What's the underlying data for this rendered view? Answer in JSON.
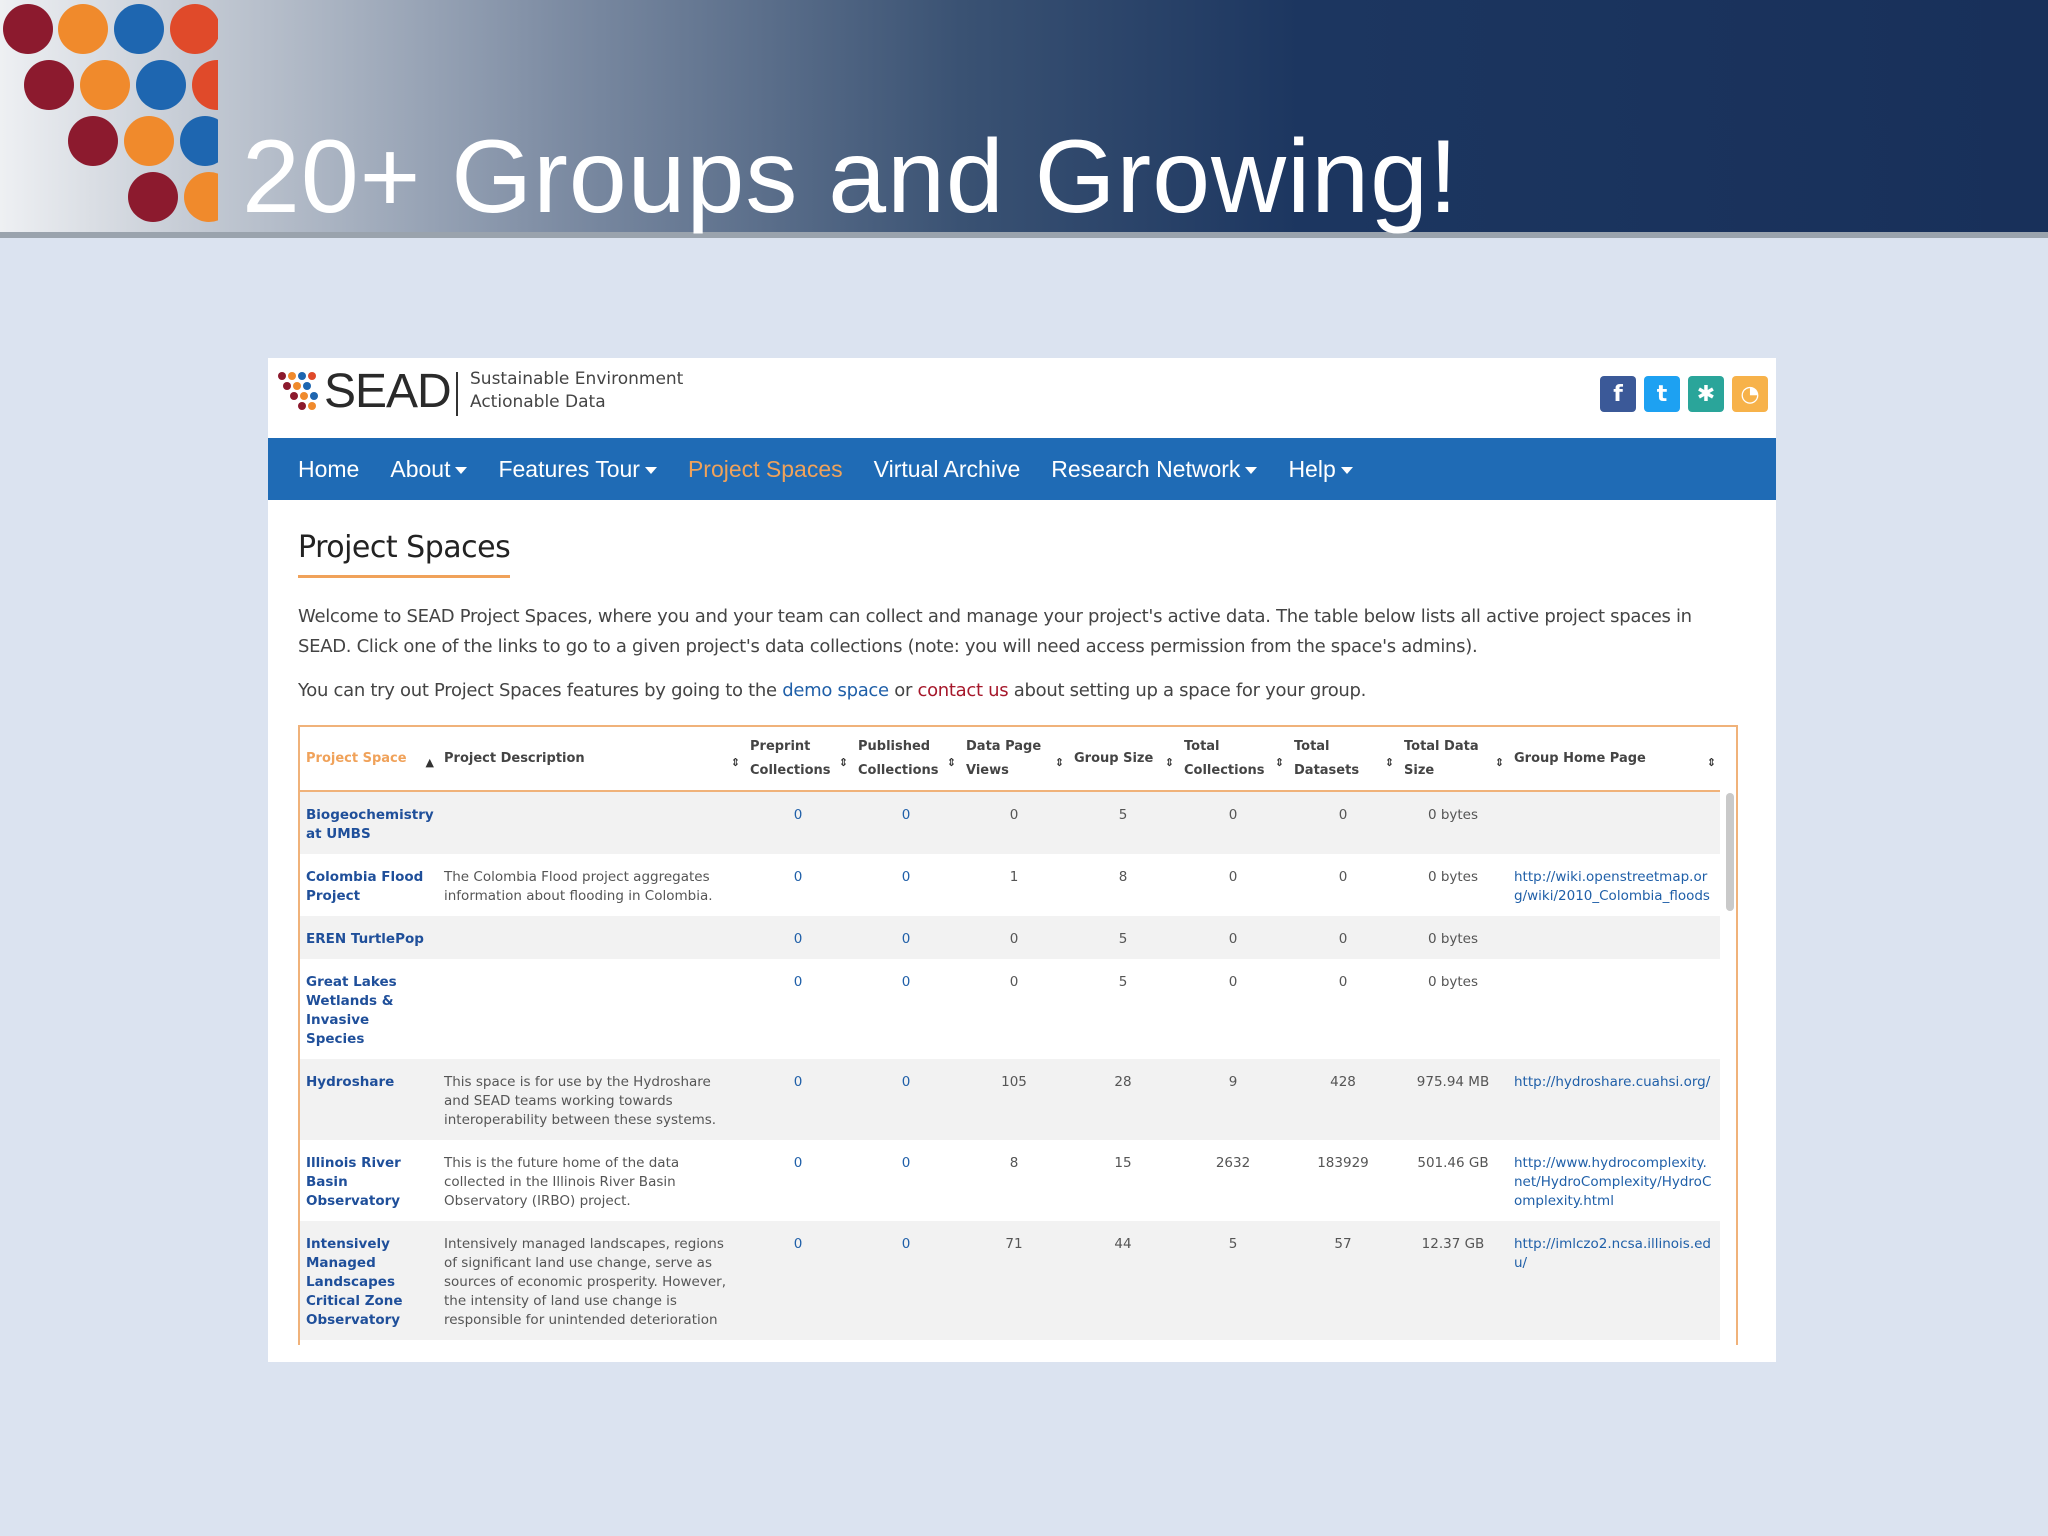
{
  "slide": {
    "title": "20+ Groups and Growing!"
  },
  "site": {
    "logo_text": "SEAD",
    "logo_sub_line1": "Sustainable Environment",
    "logo_sub_line2": "Actionable Data",
    "social_icons": [
      "facebook-icon",
      "twitter-icon",
      "share-icon",
      "rss-icon"
    ]
  },
  "nav": {
    "items": [
      {
        "label": "Home",
        "dropdown": false
      },
      {
        "label": "About",
        "dropdown": true
      },
      {
        "label": "Features Tour",
        "dropdown": true
      },
      {
        "label": "Project Spaces",
        "dropdown": false,
        "active": true
      },
      {
        "label": "Virtual Archive",
        "dropdown": false
      },
      {
        "label": "Research Network",
        "dropdown": true
      },
      {
        "label": "Help",
        "dropdown": true
      }
    ]
  },
  "page": {
    "heading": "Project Spaces",
    "intro": "Welcome to SEAD Project Spaces, where you and your team can collect and manage your project's active data. The table below lists all active project spaces in SEAD. Click one of the links to go to a given project's data collections (note: you will need access permission from the space's admins).",
    "try_prefix": "You can try out Project Spaces features by going to the ",
    "demo_link": "demo space",
    "try_middle": " or ",
    "contact_link": "contact us",
    "try_suffix": " about setting up a space for your group."
  },
  "table": {
    "headers": [
      "Project Space",
      "Project Description",
      "Preprint Collections",
      "Published Collections",
      "Data Page Views",
      "Group Size",
      "Total Collections",
      "Total Datasets",
      "Total Data Size",
      "Group Home Page"
    ],
    "rows": [
      [
        "Biogeochemistry at UMBS",
        "",
        "0",
        "0",
        "0",
        "5",
        "0",
        "0",
        "0 bytes",
        ""
      ],
      [
        "Colombia Flood Project",
        "The Colombia Flood project aggregates information about flooding in Colombia.",
        "0",
        "0",
        "1",
        "8",
        "0",
        "0",
        "0 bytes",
        "http://wiki.openstreetmap.org/wiki/2010_Colombia_floods"
      ],
      [
        "EREN TurtlePop",
        "",
        "0",
        "0",
        "0",
        "5",
        "0",
        "0",
        "0 bytes",
        ""
      ],
      [
        "Great Lakes Wetlands & Invasive Species",
        "",
        "0",
        "0",
        "0",
        "5",
        "0",
        "0",
        "0 bytes",
        ""
      ],
      [
        "Hydroshare",
        "This space is for use by the Hydroshare and SEAD teams working towards interoperability between these systems.",
        "0",
        "0",
        "105",
        "28",
        "9",
        "428",
        "975.94 MB",
        "http://hydroshare.cuahsi.org/"
      ],
      [
        "Illinois River Basin Observatory",
        "This is the future home of the data collected in the Illinois River Basin Observatory (IRBO) project.",
        "0",
        "0",
        "8",
        "15",
        "2632",
        "183929",
        "501.46 GB",
        "http://www.hydrocomplexity.net/HydroComplexity/HydroComplexity.html"
      ],
      [
        "Intensively Managed Landscapes Critical Zone Observatory",
        "Intensively managed landscapes, regions of significant land use change, serve as sources of economic prosperity. However, the intensity of land use change is responsible for unintended deterioration",
        "0",
        "0",
        "71",
        "44",
        "5",
        "57",
        "12.37 GB",
        "http://imlczo2.ncsa.illinois.edu/"
      ]
    ]
  },
  "colors": {
    "nav_bg": "#1f6bb5",
    "active_nav": "#f0a25a",
    "table_border": "#f0b27a",
    "link_blue": "#1f5fa8",
    "link_red": "#a6182b"
  }
}
